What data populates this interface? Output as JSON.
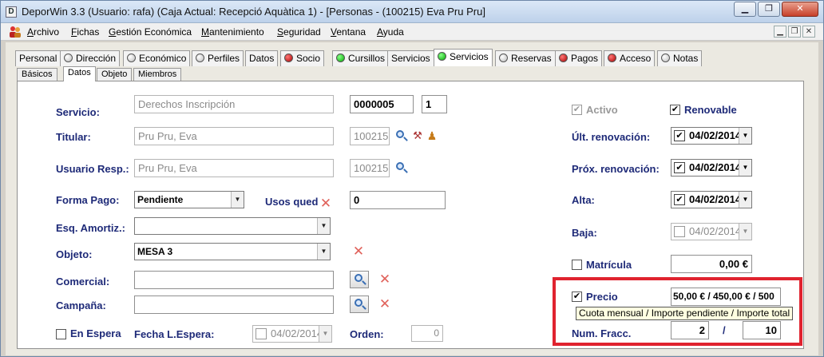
{
  "window": {
    "title": "DeporWin 3.3  (Usuario: rafa)  (Caja Actual: Recepció Aquàtica 1) - [Personas - (100215) Eva Pru Pru]",
    "app_icon_letter": "D"
  },
  "menu": [
    "Archivo",
    "Fichas",
    "Gestión Económica",
    "Mantenimiento",
    "Seguridad",
    "Ventana",
    "Ayuda"
  ],
  "tabs": [
    {
      "label": "Personal",
      "dot": ""
    },
    {
      "label": "Dirección",
      "dot": "grey"
    },
    {
      "label": "Económico",
      "dot": "grey"
    },
    {
      "label": "Perfiles",
      "dot": "grey"
    },
    {
      "label": "Datos",
      "dot": ""
    },
    {
      "label": "Socio",
      "dot": "red"
    },
    {
      "label": "Cursillos",
      "dot": "green"
    },
    {
      "label": "Servicios",
      "dot": ""
    },
    {
      "label": "Servicios",
      "dot": "green",
      "active": true
    },
    {
      "label": "Reservas",
      "dot": "grey"
    },
    {
      "label": "Pagos",
      "dot": "red"
    },
    {
      "label": "Acceso",
      "dot": "red"
    },
    {
      "label": "Notas",
      "dot": "grey"
    }
  ],
  "subtabs": [
    {
      "label": "Básicos"
    },
    {
      "label": "Datos",
      "active": true
    },
    {
      "label": "Objeto"
    },
    {
      "label": "Miembros"
    }
  ],
  "form": {
    "servicio": {
      "label": "Servicio:",
      "value": "Derechos Inscripción",
      "code": "0000005",
      "qty": "1"
    },
    "titular": {
      "label": "Titular:",
      "value": "Pru Pru, Eva",
      "code": "100215"
    },
    "usuario_resp": {
      "label": "Usuario Resp.:",
      "value": "Pru Pru, Eva",
      "code": "100215"
    },
    "forma_pago": {
      "label": "Forma Pago:",
      "value": "Pendiente"
    },
    "usos_qued": {
      "label": "Usos qued",
      "value": "0"
    },
    "esq_amortiz": {
      "label": "Esq. Amortiz.:",
      "value": ""
    },
    "objeto": {
      "label": "Objeto:",
      "value": "MESA 3"
    },
    "comercial": {
      "label": "Comercial:",
      "value": ""
    },
    "campana": {
      "label": "Campaña:",
      "value": ""
    },
    "en_espera": {
      "label": "En Espera",
      "checked": false
    },
    "fecha_espera": {
      "label": "Fecha L.Espera:",
      "value": "04/02/2014"
    },
    "orden": {
      "label": "Orden:",
      "value": "0"
    }
  },
  "right": {
    "activo": {
      "label": "Activo",
      "checked": true
    },
    "renovable": {
      "label": "Renovable",
      "checked": true
    },
    "ult_renovacion": {
      "label": "Últ. renovación:",
      "value": "04/02/2014"
    },
    "prox_renovacion": {
      "label": "Próx. renovación:",
      "value": "04/02/2014"
    },
    "alta": {
      "label": "Alta:",
      "value": "04/02/2014"
    },
    "baja": {
      "label": "Baja:",
      "value": "04/02/2014"
    },
    "matricula": {
      "label": "Matrícula",
      "value": "0,00 €",
      "checked": false
    },
    "precio": {
      "label": "Precio",
      "value": "50,00 € / 450,00 € / 500",
      "checked": true
    },
    "tooltip": "Cuota mensual / Importe pendiente / Importe total",
    "num_fracc": {
      "label": "Num. Fracc.",
      "value": "2",
      "sep": "/",
      "total": "10"
    }
  },
  "glyphs": {
    "check": "✔",
    "down": "▼",
    "close": "✕",
    "minimize": "▁",
    "restore": "❐"
  },
  "colors": {
    "highlight_box": "#e0232f",
    "label": "#1e2a78"
  }
}
